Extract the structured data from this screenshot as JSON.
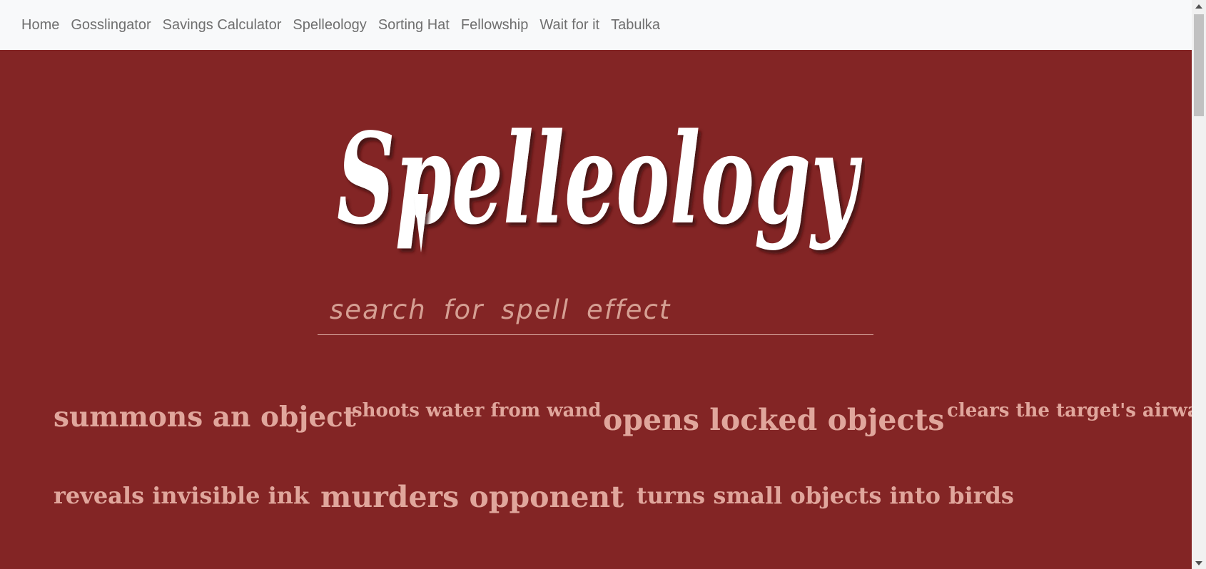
{
  "nav": {
    "items": [
      {
        "label": "Home"
      },
      {
        "label": "Gosslingator"
      },
      {
        "label": "Savings Calculator"
      },
      {
        "label": "Spelleology"
      },
      {
        "label": "Sorting Hat"
      },
      {
        "label": "Fellowship"
      },
      {
        "label": "Wait for it"
      },
      {
        "label": "Tabulka"
      }
    ]
  },
  "hero": {
    "logo_text": "Spelleology"
  },
  "search": {
    "placeholder": "search for spell effect",
    "value": ""
  },
  "effects": [
    {
      "label": "summons an object"
    },
    {
      "label": "shoots water from wand"
    },
    {
      "label": "opens locked objects"
    },
    {
      "label": "clears the target's airway"
    },
    {
      "label": "reveals invisible ink"
    },
    {
      "label": "murders opponent"
    },
    {
      "label": "turns small objects into birds"
    }
  ],
  "colors": {
    "background": "#832525",
    "navbar": "#f8f9fa",
    "nav_text": "#6f6f6f",
    "effect_text": "#e0a69c",
    "logo": "#ffffff"
  }
}
